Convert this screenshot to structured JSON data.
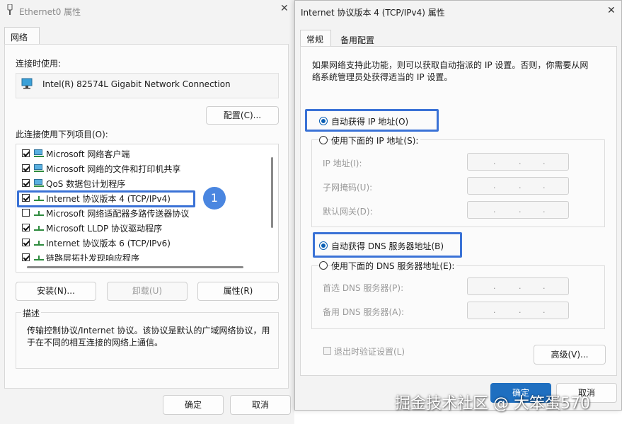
{
  "left_window": {
    "title": "Ethernet0 属性",
    "tab": "网络",
    "connect_using_label": "连接时使用:",
    "adapter_name": "Intel(R) 82574L Gigabit Network Connection",
    "configure_button": "配置(C)...",
    "items_label": "此连接使用下列项目(O):",
    "items": [
      {
        "label": "Microsoft 网络客户端",
        "checked": true,
        "icon": "network-client-icon"
      },
      {
        "label": "Microsoft 网络的文件和打印机共享",
        "checked": true,
        "icon": "network-share-icon"
      },
      {
        "label": "QoS 数据包计划程序",
        "checked": true,
        "icon": "network-service-icon"
      },
      {
        "label": "Internet 协议版本 4 (TCP/IPv4)",
        "checked": true,
        "icon": "protocol-icon"
      },
      {
        "label": "Microsoft 网络适配器多路传送器协议",
        "checked": false,
        "icon": "protocol-icon"
      },
      {
        "label": "Microsoft LLDP 协议驱动程序",
        "checked": true,
        "icon": "protocol-icon"
      },
      {
        "label": "Internet 协议版本 6 (TCP/IPv6)",
        "checked": true,
        "icon": "protocol-icon"
      },
      {
        "label": "链路层拓扑发现响应程序",
        "checked": true,
        "icon": "protocol-icon"
      }
    ],
    "install_button": "安装(N)...",
    "uninstall_button": "卸载(U)",
    "properties_button": "属性(R)",
    "description_label": "描述",
    "description_text_1": "传输控制协议/Internet 协议。该协议是默认的广域网络协议，用",
    "description_text_2": "于在不同的相互连接的网络上通信。",
    "ok_button": "确定",
    "cancel_button": "取消",
    "badge": "1"
  },
  "right_window": {
    "title": "Internet 协议版本 4 (TCP/IPv4) 属性",
    "close": "✕",
    "tabs": [
      "常规",
      "备用配置"
    ],
    "info_line_1": "如果网络支持此功能，则可以获取自动指派的 IP 设置。否则，你需要从网",
    "info_line_2": "络系统管理员处获得适当的 IP 设置。",
    "auto_ip": "自动获得 IP 地址(O)",
    "use_ip": "使用下面的 IP 地址(S):",
    "ip_address_label": "IP 地址(I):",
    "subnet_label": "子网掩码(U):",
    "gateway_label": "默认网关(D):",
    "auto_dns": "自动获得 DNS 服务器地址(B)",
    "use_dns": "使用下面的 DNS 服务器地址(E):",
    "preferred_dns_label": "首选 DNS 服务器(P):",
    "alternate_dns_label": "备用 DNS 服务器(A):",
    "ip_dot": ".",
    "validate_label": "退出时验证设置(L)",
    "advanced_button": "高级(V)...",
    "ok_button": "确定",
    "cancel_button": "取消"
  },
  "watermark": "掘金技术社区 @ 大笨蛋570",
  "colors": {
    "highlight": "#3a72d6",
    "badge": "#4a86e0",
    "radio": "#0a5fb4"
  }
}
